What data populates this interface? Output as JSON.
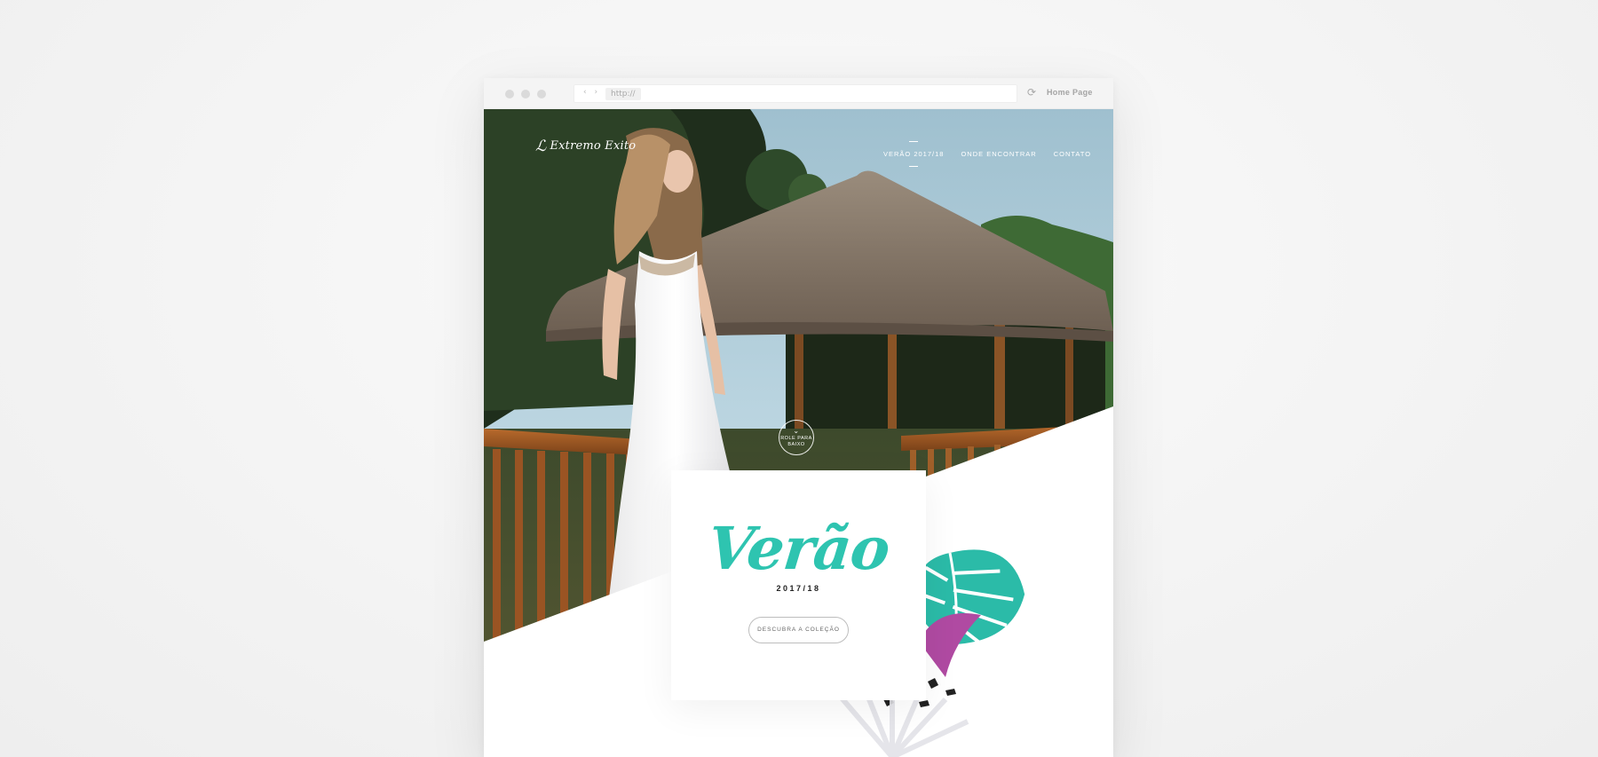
{
  "browser": {
    "url_text": "http://",
    "nav_arrows": "‹ ›",
    "home_label": "Home Page"
  },
  "site": {
    "logo_text": "Extremo Exito",
    "nav": [
      {
        "label": "VERÃO 2017/18",
        "active": true
      },
      {
        "label": "ONDE ENCONTRAR",
        "active": false
      },
      {
        "label": "CONTATO",
        "active": false
      }
    ],
    "scroll_badge": "ROLE PARA BAIXO"
  },
  "hero_card": {
    "title": "Verão",
    "year": "2017/18",
    "cta": "DESCUBRA A COLEÇÃO"
  },
  "colors": {
    "accent": "#2ec4b0",
    "page_bg": "#f3f3f3"
  },
  "icons": {
    "reload": "reload-icon",
    "scroll": "chevron-down-icon",
    "logo": "bird-logo-icon"
  }
}
